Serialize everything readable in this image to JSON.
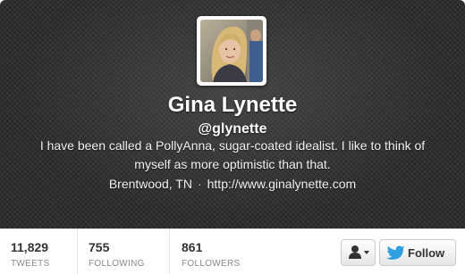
{
  "profile": {
    "name": "Gina Lynette",
    "handle": "@glynette",
    "bio": "I have been called a PollyAnna, sugar-coated idealist. I like to think of myself as more optimistic than that.",
    "location": "Brentwood, TN",
    "separator": "·",
    "website": "http://www.ginalynette.com"
  },
  "stats": {
    "tweets": {
      "count": "11,829",
      "label": "TWEETS"
    },
    "following": {
      "count": "755",
      "label": "FOLLOWING"
    },
    "followers": {
      "count": "861",
      "label": "FOLLOWERS"
    }
  },
  "actions": {
    "follow_label": "Follow",
    "user_menu_icon": "person-icon",
    "follow_icon": "twitter-bird-icon"
  },
  "colors": {
    "header_bg": "#2a2a2a",
    "twitter_blue": "#2f9fe0"
  }
}
